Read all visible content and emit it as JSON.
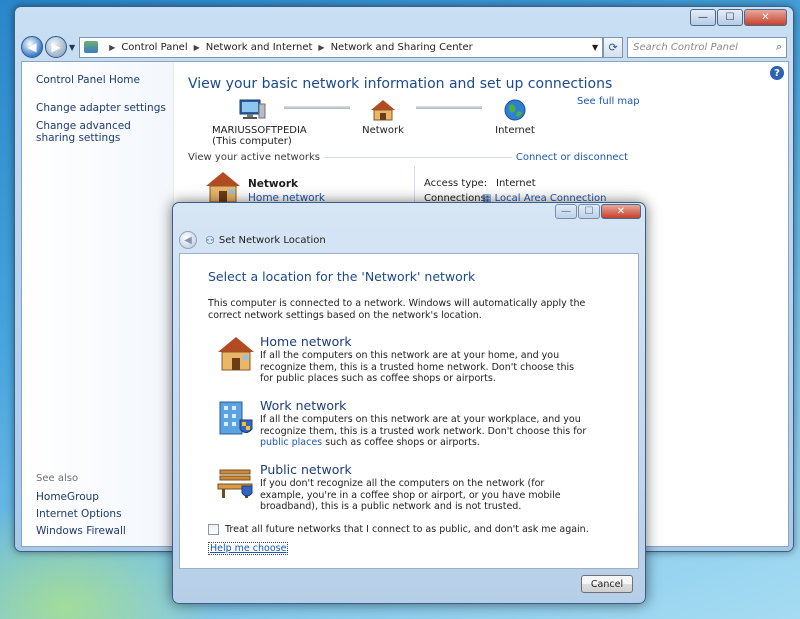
{
  "window": {
    "controls": {
      "minimize": "—",
      "maximize": "☐",
      "close": "✕"
    },
    "breadcrumb": [
      "Control Panel",
      "Network and Internet",
      "Network and Sharing Center"
    ],
    "search_placeholder": "Search Control Panel"
  },
  "sidebar": {
    "home": "Control Panel Home",
    "links": [
      "Change adapter settings",
      "Change advanced sharing settings"
    ],
    "see_also_heading": "See also",
    "see_also": [
      "HomeGroup",
      "Internet Options",
      "Windows Firewall"
    ]
  },
  "main": {
    "title": "View your basic network information and set up connections",
    "see_full_map": "See full map",
    "computer_name": "MARIUSSOFTPEDIA",
    "computer_sub": "(This computer)",
    "network_node": "Network",
    "internet_node": "Internet",
    "active_networks_label": "View your active networks",
    "connect_disconnect": "Connect or disconnect",
    "network_name": "Network",
    "network_type": "Home network",
    "access_type_label": "Access type:",
    "access_type_value": "Internet",
    "connections_label": "Connections:",
    "connections_value": "Local Area Connection"
  },
  "dialog": {
    "title": "Set Network Location",
    "heading": "Select a location for the 'Network' network",
    "intro": "This computer is connected to a network. Windows will automatically apply the correct network settings based on the network's location.",
    "options": [
      {
        "title": "Home network",
        "desc": "If all the computers on this network are at your home, and you recognize them, this is a trusted home network. Don't choose this for public places such as coffee shops or airports.",
        "icon": "house-icon"
      },
      {
        "title": "Work network",
        "desc_a": "If all the computers on this network are at your workplace, and you recognize them, this is a trusted work network. Don't choose this for ",
        "desc_link": "public places",
        "desc_b": " such as coffee shops or airports.",
        "icon": "office-building-icon"
      },
      {
        "title": "Public network",
        "desc": "If you don't recognize all the computers on the network (for example, you're in a coffee shop or airport, or you have mobile broadband), this is a public network and is not trusted.",
        "icon": "park-bench-icon"
      }
    ],
    "checkbox_label": "Treat all future networks that I connect to as public, and don't ask me again.",
    "help_link": "Help me choose",
    "cancel": "Cancel"
  },
  "colors": {
    "accent_blue": "#1b4a8f",
    "link_blue": "#1a56b4",
    "title_bar": "#b6cfe8"
  }
}
